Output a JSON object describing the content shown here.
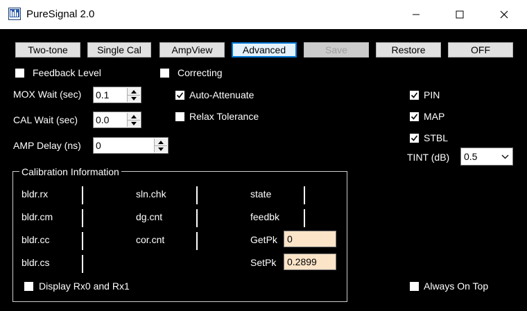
{
  "window": {
    "title": "PureSignal 2.0"
  },
  "toolbar": {
    "two_tone": "Two-tone",
    "single_cal": "Single Cal",
    "ampview": "AmpView",
    "advanced": "Advanced",
    "save": "Save",
    "restore": "Restore",
    "off": "OFF"
  },
  "options": {
    "feedback_level": {
      "label": "Feedback Level",
      "checked": false
    },
    "correcting": {
      "label": "Correcting",
      "checked": false
    },
    "auto_attenuate": {
      "label": "Auto-Attenuate",
      "checked": true
    },
    "relax_tolerance": {
      "label": "Relax Tolerance",
      "checked": false
    },
    "pin": {
      "label": "PIN",
      "checked": true
    },
    "map": {
      "label": "MAP",
      "checked": true
    },
    "stbl": {
      "label": "STBL",
      "checked": true
    },
    "display_rx": {
      "label": "Display Rx0 and Rx1",
      "checked": false
    },
    "always_on_top": {
      "label": "Always On Top",
      "checked": false
    }
  },
  "timing": {
    "mox_wait": {
      "label": "MOX Wait (sec)",
      "value": "0.1"
    },
    "cal_wait": {
      "label": "CAL Wait (sec)",
      "value": "0.0"
    },
    "amp_delay": {
      "label": "AMP Delay (ns)",
      "value": "0"
    }
  },
  "tint": {
    "label": "TINT (dB)",
    "value": "0.5"
  },
  "calibration": {
    "title": "Calibration Information",
    "col1": [
      "bldr.rx",
      "bldr.cm",
      "bldr.cc",
      "bldr.cs"
    ],
    "col2": [
      "sln.chk",
      "dg.cnt",
      "cor.cnt"
    ],
    "col3": [
      "state",
      "feedbk"
    ],
    "getpk": {
      "label": "GetPk",
      "value": "0"
    },
    "setpk": {
      "label": "SetPk",
      "value": "0.2899"
    }
  }
}
